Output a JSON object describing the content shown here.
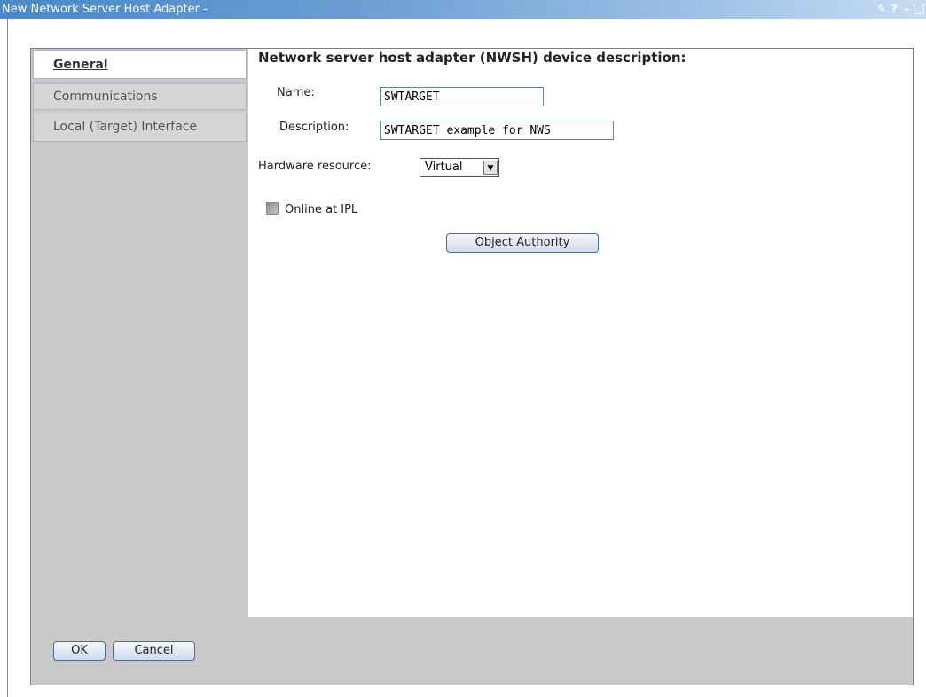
{
  "window": {
    "title": "New Network Server Host Adapter -",
    "icons": [
      "edit-icon",
      "help-icon",
      "minimize-icon",
      "maximize-icon"
    ]
  },
  "tabs": [
    {
      "label": "General",
      "active": true
    },
    {
      "label": "Communications",
      "active": false
    },
    {
      "label": "Local (Target) Interface",
      "active": false
    }
  ],
  "form": {
    "heading": "Network server host adapter (NWSH) device description:",
    "name_label": "Name:",
    "name_value": "SWTARGET",
    "description_label": "Description:",
    "description_value": "SWTARGET example for NWS",
    "hardware_label": "Hardware resource:",
    "hardware_value": "Virtual",
    "online_label": "Online at IPL",
    "online_checked": false,
    "object_authority_label": "Object Authority"
  },
  "footer": {
    "ok_label": "OK",
    "cancel_label": "Cancel"
  }
}
